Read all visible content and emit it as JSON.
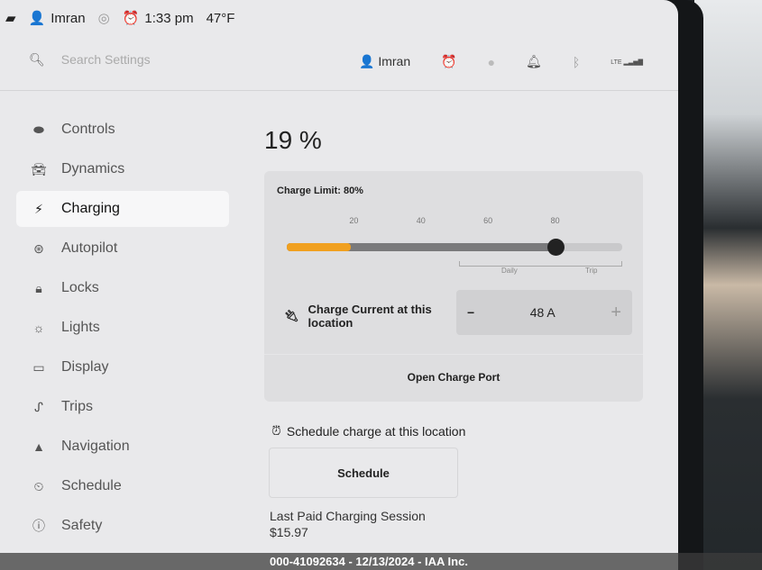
{
  "status_bar": {
    "user": "Imran",
    "time": "1:33 pm",
    "temperature": "47°F"
  },
  "header": {
    "search_placeholder": "Search Settings",
    "user": "Imran",
    "lte": "LTE"
  },
  "sidebar": {
    "items": [
      {
        "label": "Controls",
        "icon": "toggle-icon"
      },
      {
        "label": "Dynamics",
        "icon": "car-icon"
      },
      {
        "label": "Charging",
        "icon": "bolt-icon",
        "active": true
      },
      {
        "label": "Autopilot",
        "icon": "steering-wheel-icon"
      },
      {
        "label": "Locks",
        "icon": "lock-icon"
      },
      {
        "label": "Lights",
        "icon": "sun-icon"
      },
      {
        "label": "Display",
        "icon": "display-icon"
      },
      {
        "label": "Trips",
        "icon": "trips-icon"
      },
      {
        "label": "Navigation",
        "icon": "navigation-icon"
      },
      {
        "label": "Schedule",
        "icon": "clock-icon"
      },
      {
        "label": "Safety",
        "icon": "safety-icon"
      }
    ]
  },
  "charging": {
    "battery_percent": "19 %",
    "current_charge": 19,
    "charge_limit_label": "Charge Limit: 80%",
    "charge_limit": 80,
    "ticks": [
      "20",
      "40",
      "60",
      "80"
    ],
    "daily_label": "Daily",
    "trip_label": "Trip",
    "charge_current_label": "Charge Current at this location",
    "charge_current_value": "48 A",
    "minus": "−",
    "plus": "+",
    "open_port": "Open Charge Port",
    "schedule_heading": "Schedule charge at this location",
    "schedule_button": "Schedule",
    "last_session": "Last Paid Charging Session",
    "last_price": "$15.97"
  },
  "colors": {
    "accent": "#f0a020"
  },
  "watermark": "000-41092634 - 12/13/2024 - IAA Inc."
}
